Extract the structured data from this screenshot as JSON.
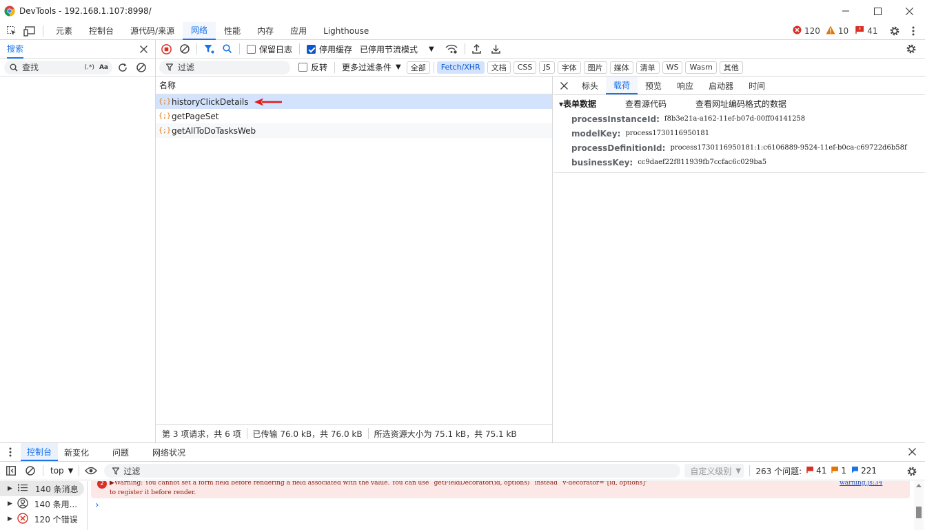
{
  "window": {
    "title": "DevTools - 192.168.1.107:8998/"
  },
  "main_tabs": [
    "元素",
    "控制台",
    "源代码/来源",
    "网络",
    "性能",
    "内存",
    "应用",
    "Lighthouse"
  ],
  "active_main_tab": "网络",
  "counters": {
    "errors": "120",
    "warnings": "10",
    "issues": "41"
  },
  "search_panel": {
    "title": "搜索",
    "placeholder": "查找",
    "regex": "(.*)",
    "case": "Aa"
  },
  "network_toolbar": {
    "preserve_log": "保留日志",
    "disable_cache": "停用缓存",
    "throttle": "已停用节流模式"
  },
  "filter_bar": {
    "placeholder": "过滤",
    "invert": "反转",
    "more_filters": "更多过滤条件",
    "chips": [
      "全部",
      "Fetch/XHR",
      "文档",
      "CSS",
      "JS",
      "字体",
      "图片",
      "媒体",
      "清单",
      "WS",
      "Wasm",
      "其他"
    ],
    "active_chip": "Fetch/XHR"
  },
  "requests": {
    "column_name": "名称",
    "items": [
      "historyClickDetails",
      "getPageSet",
      "getAllToDoTasksWeb"
    ]
  },
  "status_bar": {
    "requests": "第 3 项请求，共 6 项",
    "transferred": "已传输 76.0 kB，共 76.0 kB",
    "resources": "所选资源大小为 75.1 kB，共 75.1 kB"
  },
  "detail": {
    "tabs": [
      "标头",
      "载荷",
      "预览",
      "响应",
      "启动器",
      "时间"
    ],
    "active_tab": "载荷",
    "section_title": "▾表单数据",
    "view_source": "查看源代码",
    "view_url_encoded": "查看网址编码格式的数据",
    "fields": [
      {
        "key": "processInstanceId:",
        "value": "f8b3e21a-a162-11ef-b07d-00ff04141258"
      },
      {
        "key": "modelKey:",
        "value": "process1730116950181"
      },
      {
        "key": "processDefinitionId:",
        "value": "process1730116950181:1:c6106889-9524-11ef-b0ca-c69722d6b58f"
      },
      {
        "key": "businessKey:",
        "value": "cc9daef22f811939fb7ccfac6c029ba5"
      }
    ]
  },
  "drawer": {
    "tabs": [
      "控制台",
      "新变化",
      "问题",
      "网络状况"
    ],
    "active_tab": "控制台",
    "context": "top",
    "filter_placeholder": "过滤",
    "level": "自定义级别",
    "issues_label": "263 个问题:",
    "issue_counts": {
      "errors": "41",
      "warnings": "1",
      "info": "221"
    },
    "sidebar": [
      {
        "label": "140 条消息",
        "icon": "list-icon"
      },
      {
        "label": "140 条用...",
        "icon": "user-icon"
      },
      {
        "label": "120 个错误",
        "icon": "error-icon"
      }
    ],
    "message": {
      "count": "2",
      "text_line1": "▶Warning: You cannot set a form field before rendering a field associated with the value. You can use `getFieldDecorator(id, options)` instead `v-decorator=\"[id, options]\"`",
      "text_line2": "to register it before render.",
      "source": "warning.js:34"
    },
    "prompt": "›"
  },
  "colors": {
    "accent": "#1a73e8",
    "error": "#d93025",
    "warning": "#e37400",
    "selected_row": "#d3e3fd"
  }
}
